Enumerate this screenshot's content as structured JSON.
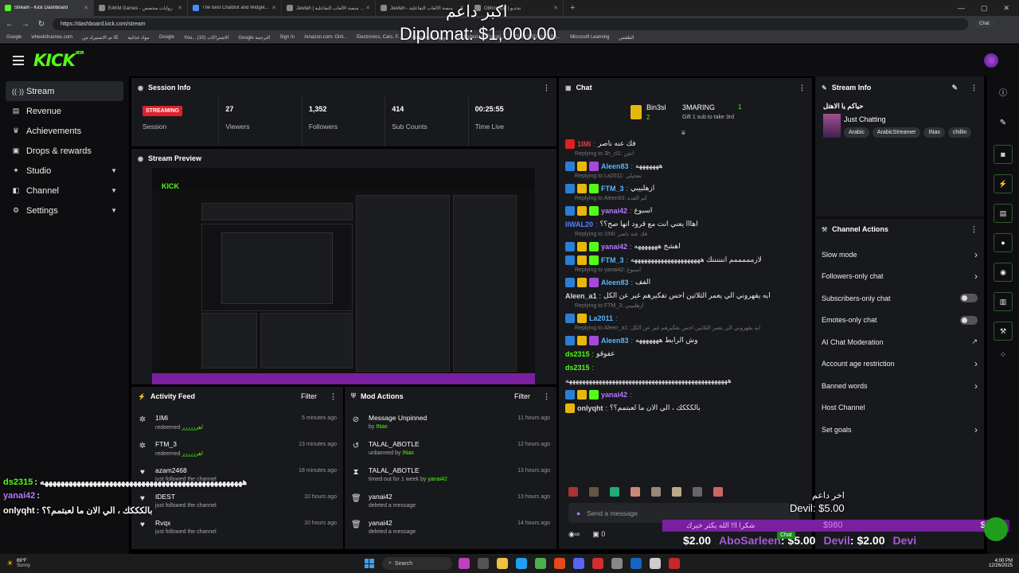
{
  "browser": {
    "tabs": [
      {
        "label": "Stream - Kick Dashboard",
        "color": "#53fc18"
      },
      {
        "label": "E4KM Games - روايات مخصص",
        "color": "#888888"
      },
      {
        "label": "The best ChatBot and Widgets fo",
        "color": "#4a8cff"
      },
      {
        "label": "Jawlah | جولة - منصة الألعاب التفاعلية",
        "color": "#888888"
      },
      {
        "label": "Jawlah - منصة الألعاب التفاعلية",
        "color": "#888888"
      },
      {
        "label": "Obhm.app | تحديو",
        "color": "#888888"
      }
    ],
    "url": "https://dashboard.kick.com/stream",
    "chat_button": "Chat",
    "bookmarks": [
      "Google",
      "wheelofnames.com",
      "تم الاستيراد من IE",
      "مواد غذائية",
      "Google",
      "You... (10) الاشتراكات",
      "Google الترجمة",
      "Sign In",
      "Amazon.com: Onli...",
      "Electronics, Cars, F...",
      "AliExpress - موقع",
      "Fishisfast US Parcel...",
      "15.28 USD to SAR |...",
      "Microsoft Learning",
      "الطقس"
    ]
  },
  "sidebar": {
    "items": [
      {
        "label": "Stream",
        "icon": "broadcast-icon",
        "glyph": "((·))"
      },
      {
        "label": "Revenue",
        "icon": "money-icon",
        "glyph": "▤"
      },
      {
        "label": "Achievements",
        "icon": "trophy-icon",
        "glyph": "♛"
      },
      {
        "label": "Drops & rewards",
        "icon": "gift-icon",
        "glyph": "▣"
      },
      {
        "label": "Studio",
        "icon": "studio-icon",
        "glyph": "✦"
      },
      {
        "label": "Channel",
        "icon": "channel-icon",
        "glyph": "◧"
      },
      {
        "label": "Settings",
        "icon": "gear-icon",
        "glyph": "⚙"
      }
    ]
  },
  "session": {
    "title": "Session Info",
    "status": "STREAMING",
    "status_label": "Session",
    "stats": [
      {
        "value": "27",
        "label": "Viewers"
      },
      {
        "value": "1,352",
        "label": "Followers"
      },
      {
        "value": "414",
        "label": "Sub Counts"
      },
      {
        "value": "00:25:55",
        "label": "Time Live"
      }
    ]
  },
  "preview": {
    "title": "Stream Preview"
  },
  "activity": {
    "title": "Activity Feed",
    "filter": "Filter",
    "items": [
      {
        "name": "1IMi",
        "action": "redeemed",
        "reward": "اهرررررر",
        "time": "5 minutes ago",
        "icon": "redeem-icon",
        "glyph": "✲"
      },
      {
        "name": "FTM_3",
        "action": "redeemed",
        "reward": "اهرررررر",
        "time": "13 minutes ago",
        "icon": "redeem-icon",
        "glyph": "✲"
      },
      {
        "name": "azam2468",
        "action": "just followed the channel",
        "reward": "",
        "time": "18 minutes ago",
        "icon": "heart-icon",
        "glyph": "♥"
      },
      {
        "name": "IDEST",
        "action": "just followed the channel",
        "reward": "",
        "time": "10 hours ago",
        "icon": "heart-icon",
        "glyph": "♥"
      },
      {
        "name": "Rvqx",
        "action": "just followed the channel",
        "reward": "",
        "time": "10 hours ago",
        "icon": "heart-icon",
        "glyph": "♥"
      }
    ]
  },
  "mod": {
    "title": "Mod Actions",
    "filter": "Filter",
    "items": [
      {
        "name": "Message Unpinned",
        "by": "by",
        "who": "INas",
        "time": "11 hours ago",
        "icon": "unpin-icon",
        "glyph": "⊘"
      },
      {
        "name": "TALAL_ABOTLE",
        "by": "unbanned by",
        "who": "INas",
        "time": "12 hours ago",
        "icon": "unban-icon",
        "glyph": "↺"
      },
      {
        "name": "TALAL_ABOTLE",
        "by": "timed out for 1 week by",
        "who": "yanai42",
        "time": "13 hours ago",
        "icon": "hourglass-icon",
        "glyph": "⧗"
      },
      {
        "name": "yanai42",
        "by": "deleted a message",
        "who": "",
        "time": "13 hours ago",
        "icon": "trash-icon",
        "glyph": "🗑"
      },
      {
        "name": "yanai42",
        "by": "deleted a message",
        "who": "",
        "time": "14 hours ago",
        "icon": "trash-icon",
        "glyph": "🗑"
      }
    ]
  },
  "chat": {
    "title": "Chat",
    "leader1": {
      "name": "Bin3sl",
      "count": "2"
    },
    "leader2": {
      "name": "3MARING",
      "count": "1",
      "gift": "Gift 1 sub to take 3rd"
    },
    "messages": [
      {
        "reply": "",
        "user": "1IMi",
        "color": "#e04040",
        "badges": [
          "r"
        ],
        "text": "فك عنه ناصر"
      },
      {
        "reply": "Replying to 3h_cl1: انفن",
        "user": "Aleen83",
        "color": "#5ab4ff",
        "badges": [
          "b",
          "y",
          "p"
        ],
        "text": "هههههههه"
      },
      {
        "reply": "Replying to La2011: تعجيلي",
        "user": "FTM_3",
        "color": "#5ab4ff",
        "badges": [
          "b",
          "y",
          "g"
        ],
        "text": "ازهلبيبي"
      },
      {
        "reply": "Replying to Aleen83: كم العده",
        "user": "yanai42",
        "color": "#b57aff",
        "badges": [
          "b",
          "y",
          "g"
        ],
        "text": "اسبوع"
      },
      {
        "reply": "",
        "user": "IIWAL20",
        "color": "#5a7cff",
        "badges": [],
        "text": "اهااا يعني انت مع قرود انها صح؟؟"
      },
      {
        "reply": "Replying to 1IMi: فك عنه ناصر",
        "user": "yanai42",
        "color": "#b57aff",
        "badges": [
          "b",
          "y",
          "g"
        ],
        "text": "اهشخ هههههههه"
      },
      {
        "reply": "",
        "user": "FTM_3",
        "color": "#5ab4ff",
        "badges": [
          "b",
          "y",
          "g"
        ],
        "text": "لازمممممم اننننننك هههههههههههههههههههههه"
      },
      {
        "reply": "Replying to yanai42: اسبوع",
        "user": "Aleen83",
        "color": "#5ab4ff",
        "badges": [
          "b",
          "y",
          "p"
        ],
        "text": "الفف"
      },
      {
        "reply": "",
        "user": "Aleen_a1",
        "color": "#d8d8d8",
        "badges": [],
        "text": "ايه يقهروني الي يعمر الثلاثين احس تفكيرهم غير عن الكل"
      },
      {
        "reply": "Replying to FTM_3: ازهلبيبي",
        "user": "La2011",
        "color": "#5ab4ff",
        "badges": [
          "b",
          "y"
        ],
        "text": ""
      },
      {
        "reply": "Replying to Aleen_a1: ايه يقهروني الي يعمر الثلاثين احس تفكيرهم غير عن الكل",
        "user": "Aleen83",
        "color": "#5ab4ff",
        "badges": [
          "b",
          "y",
          "p"
        ],
        "text": "وش الرابط هههههههه"
      },
      {
        "reply": "",
        "user": "ds2315",
        "color": "#53fc18",
        "badges": [],
        "text": "عفوقو"
      },
      {
        "reply": "",
        "user": "ds2315",
        "color": "#53fc18",
        "badges": [],
        "text": ""
      },
      {
        "reply": "",
        "user": "",
        "color": "#eeeeee",
        "badges": [],
        "text": "هههههههههههههههههههههههههههههههههههههههههههههههههه"
      },
      {
        "reply": "",
        "user": "yanai42",
        "color": "#b57aff",
        "badges": [
          "b",
          "y",
          "g"
        ],
        "text": ""
      },
      {
        "reply": "",
        "user": "onlyqht",
        "color": "#d8d8d8",
        "badges": [
          "y"
        ],
        "text": "بالكككك ، الي الان ما لعبتمم؟؟"
      }
    ],
    "input_placeholder": "Send a message",
    "bottom_count": "0"
  },
  "stream_info": {
    "title": "Stream Info",
    "stream_title": "حياكم يا الاهتل",
    "category": "Just Chatting",
    "tags": [
      "Arabic",
      "ArabicStreamer",
      "INas",
      "chillin"
    ]
  },
  "channel_actions": {
    "title": "Channel Actions",
    "items": [
      {
        "label": "Slow mode",
        "control": "arrow"
      },
      {
        "label": "Followers-only chat",
        "control": "arrow"
      },
      {
        "label": "Subscribers-only chat",
        "control": "toggle"
      },
      {
        "label": "Emotes-only chat",
        "control": "toggle"
      },
      {
        "label": "AI Chat Moderation",
        "control": "external"
      },
      {
        "label": "Account age restriction",
        "control": "arrow"
      },
      {
        "label": "Banned words",
        "control": "arrow"
      },
      {
        "label": "Host Channel",
        "control": "none"
      },
      {
        "label": "Set goals",
        "control": "arrow"
      }
    ]
  },
  "overlay": {
    "top_arabic": "اكبر داعم",
    "top_amount": "Diplomat: $1,000.00",
    "right_arabic": "اخر داعم",
    "right_amount": "Devil: $5.00",
    "goal_text": "شكرا ا!! الله يكثر خيرك",
    "goal_current": "$980",
    "goal_target": "$1000",
    "ticker": [
      {
        "text": "$2.00",
        "color": "#ffffff"
      },
      {
        "text": "AboSarleen",
        "color": "#a85ad8"
      },
      {
        "text": ": $5.00",
        "color": "#ffffff"
      },
      {
        "text": "Devil",
        "color": "#a85ad8"
      },
      {
        "text": ": $2.00",
        "color": "#ffffff"
      },
      {
        "text": "Devi",
        "color": "#a85ad8"
      }
    ],
    "chat_tag": "Chat",
    "left_chat": [
      {
        "user": "ds2315",
        "text": ": ههههههههههههههههههههههههههههههههههههههههههههههههههه",
        "color": "#53fc18"
      },
      {
        "user": "yanai42",
        "text": ":",
        "color": "#b57aff"
      },
      {
        "user": "onlyqht",
        "text": ": بالكككك ، الي الان ما لعبتمم؟؟",
        "color": "#ffffff"
      }
    ]
  },
  "taskbar": {
    "weather_temp": "69°F",
    "weather_desc": "Sunny",
    "search": "Search",
    "time": "4:00 PM",
    "date": "12/26/2025"
  }
}
